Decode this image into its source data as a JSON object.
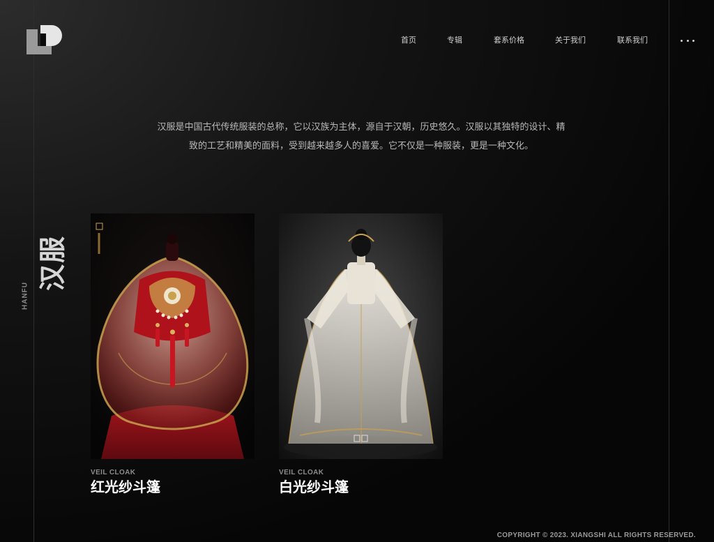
{
  "nav": {
    "items": [
      {
        "label": "首页"
      },
      {
        "label": "专辑"
      },
      {
        "label": "套系价格"
      },
      {
        "label": "关于我们"
      },
      {
        "label": "联系我们"
      }
    ]
  },
  "intro": {
    "line1": "汉服是中国古代传统服装的总称，它以汉族为主体，源自于汉朝，历史悠久。汉服以其独特的设计、精",
    "line2": "致的工艺和精美的面料，受到越来越多人的喜爱。它不仅是一种服装，更是一种文化。"
  },
  "side": {
    "title": "汉服",
    "subtitle": "HANFU"
  },
  "cards": [
    {
      "sub": "VEIL CLOAK",
      "name": "红光纱斗篷"
    },
    {
      "sub": "VEIL CLOAK",
      "name": "白光纱斗篷"
    }
  ],
  "footer": {
    "copyright": "COPYRIGHT © 2023. XIANGSHI ALL RIGHTS RESERVED."
  },
  "colors": {
    "background": "#070707",
    "nav_text": "#cfcfcf",
    "red_cloak": "#b3121c",
    "gold": "#c9a14e"
  }
}
